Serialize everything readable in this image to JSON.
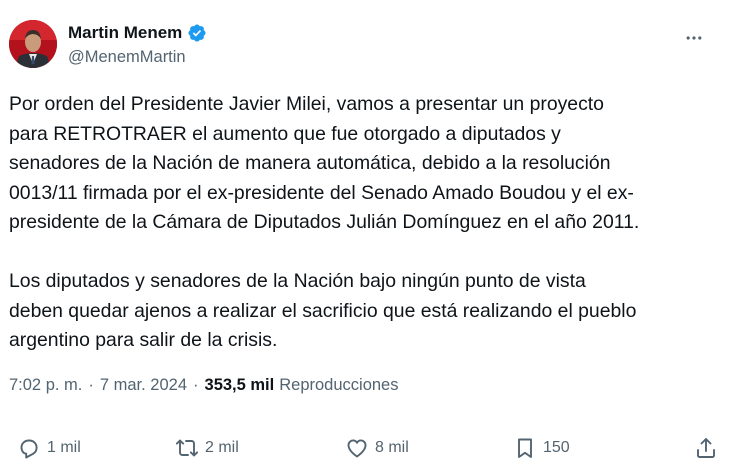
{
  "author": {
    "display_name": "Martin Menem",
    "handle": "@MenemMartin",
    "verified": true
  },
  "tweet": {
    "lines_p1": [
      "Por orden del Presidente Javier Milei, vamos a presentar un proyecto",
      "para RETROTRAER el aumento que fue otorgado a diputados y",
      "senadores de la Nación de manera automática, debido a la resolución",
      "0013/11 firmada por el ex-presidente del Senado Amado Boudou y el ex-",
      "presidente de la Cámara de Diputados Julián Domínguez en el año 2011."
    ],
    "lines_p2": [
      "Los diputados y senadores de la Nación bajo ningún punto de vista",
      "deben quedar ajenos a realizar el sacrificio que está realizando el pueblo",
      "argentino para salir de la crisis."
    ]
  },
  "meta": {
    "time": "7:02 p. m.",
    "date": "7 mar. 2024",
    "separator": "·",
    "views_count": "353,5 mil",
    "views_label": "Reproducciones"
  },
  "actions": {
    "replies": "1 mil",
    "retweets": "2 mil",
    "likes": "8 mil",
    "bookmarks": "150"
  },
  "colors": {
    "text": "#0f1419",
    "secondary": "#536471",
    "verified": "#1d9bf0",
    "background": "#ffffff"
  },
  "icons": {
    "more": "more-horizontal-icon",
    "verified": "verified-badge-icon",
    "reply": "reply-icon",
    "retweet": "retweet-icon",
    "like": "heart-icon",
    "bookmark": "bookmark-icon",
    "share": "share-icon"
  }
}
